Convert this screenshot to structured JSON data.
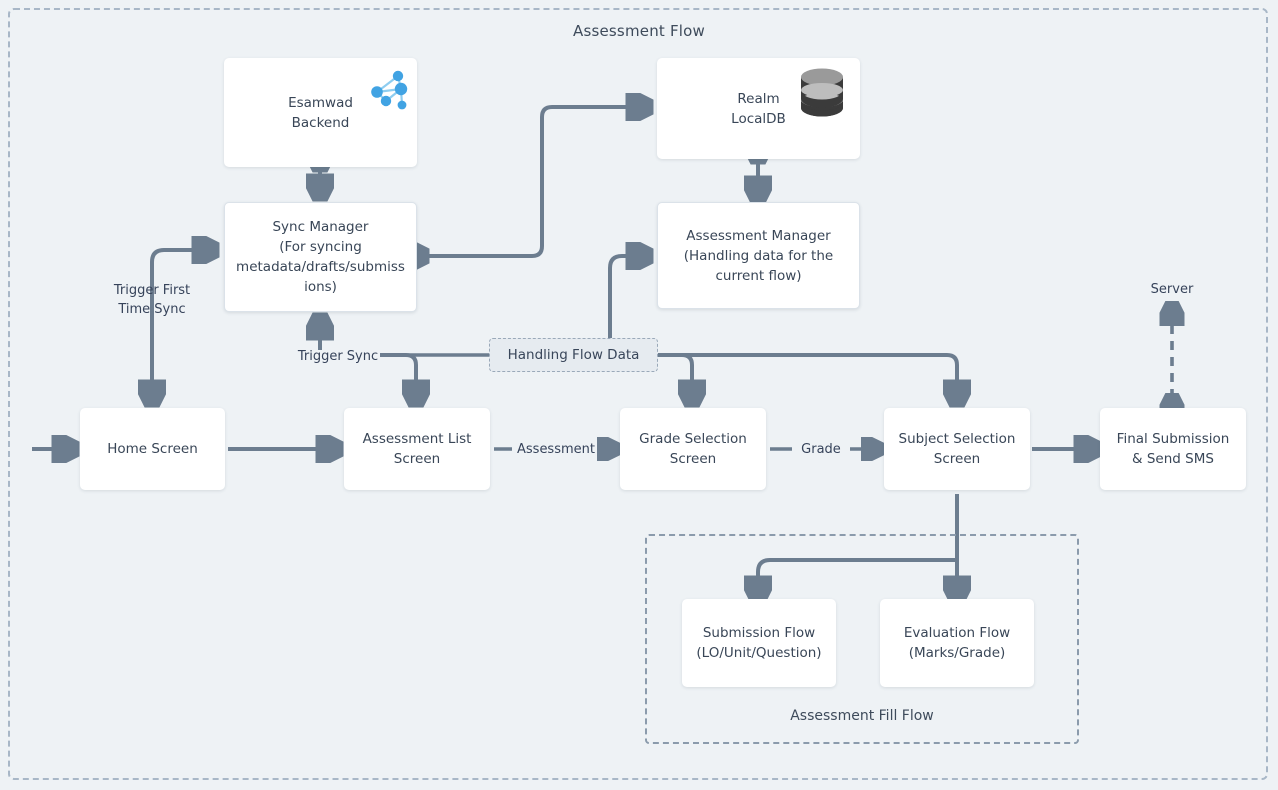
{
  "diagram": {
    "title": "Assessment Flow",
    "nodes": {
      "esamwad": "Esamwad\nBackend",
      "realm": "Realm\nLocalDB",
      "sync_manager": "Sync Manager\n(For syncing\nmetadata/drafts/submiss\nions)",
      "assessment_manager": "Assessment Manager\n(Handling data for the\ncurrent flow)",
      "home_screen": "Home Screen",
      "assessment_list": "Assessment List\nScreen",
      "grade_selection": "Grade Selection\nScreen",
      "subject_selection": "Subject Selection\nScreen",
      "final_submission": "Final Submission\n& Send SMS",
      "submission_flow": "Submission Flow\n(LO/Unit/Question)",
      "evaluation_flow": "Evaluation Flow\n(Marks/Grade)"
    },
    "pills": {
      "handling_flow_data": "Handling Flow Data"
    },
    "edge_labels": {
      "trigger_first_time_sync": "Trigger First\nTime Sync",
      "trigger_sync": "Trigger Sync",
      "assessment": "Assessment",
      "grade": "Grade",
      "server": "Server"
    },
    "groups": {
      "assessment_fill_flow": "Assessment Fill Flow"
    },
    "icons": {
      "network": "network-graph-icon",
      "database": "database-cylinder-icon"
    },
    "colors": {
      "background": "#eef2f5",
      "node_fill": "#ffffff",
      "wire": "#6c7d8f",
      "dashed_border": "#8b9bac",
      "text": "#394657",
      "network_icon": "#41a3e3",
      "database_icon": "#3b3b3b"
    }
  }
}
